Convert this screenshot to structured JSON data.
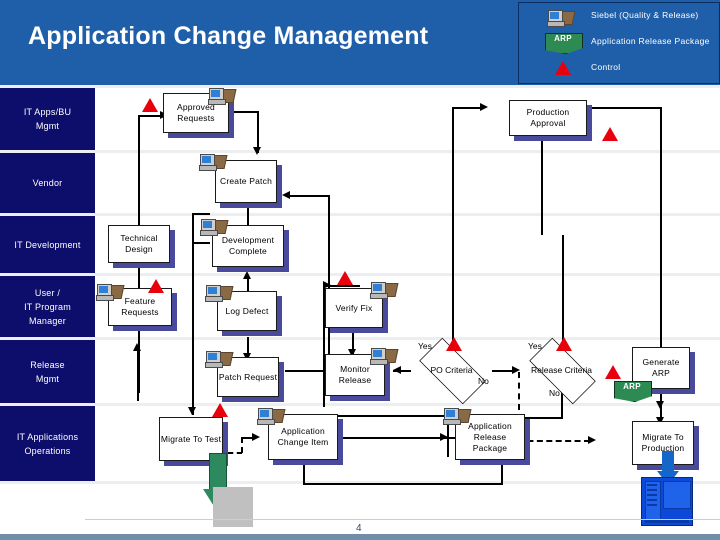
{
  "header": {
    "title": "Application Change Management",
    "banner_color": "#1f5fa9"
  },
  "legend": {
    "items": [
      {
        "icon": "computer-icon",
        "label": "Siebel (Quality & Release)"
      },
      {
        "icon": "arp-flag-icon",
        "label": "Application Release Package",
        "badge": "ARP"
      },
      {
        "icon": "control-triangle-icon",
        "label": "Control"
      }
    ]
  },
  "lanes": [
    {
      "label": "IT Apps/BU\nMgmt",
      "line1": "IT Apps/BU",
      "line2": "Mgmt"
    },
    {
      "label": "Vendor",
      "line1": "Vendor",
      "line2": ""
    },
    {
      "label": "IT Development",
      "line1": "IT Development",
      "line2": ""
    },
    {
      "label": "User / IT Program Manager",
      "line1": "User /",
      "line2": "IT Program",
      "line3": "Manager"
    },
    {
      "label": "Release Mgmt",
      "line1": "Release",
      "line2": "Mgmt"
    },
    {
      "label": "IT Applications Operations",
      "line1": "IT Applications",
      "line2": "Operations"
    }
  ],
  "nodes": {
    "approved_requests": "Approved Requests",
    "production_approval": "Production Approval",
    "create_patch": "Create Patch",
    "technical_design": "Technical Design",
    "development_complete": "Development Complete",
    "feature_requests": "Feature Requests",
    "log_defect": "Log Defect",
    "verify_fix": "Verify Fix",
    "patch_request": "Patch Request",
    "monitor_release": "Monitor Release",
    "generate_arp": "Generate ARP",
    "migrate_to_test": "Migrate To Test",
    "application_change_item": "Application Change Item",
    "application_release_package": "Application Release Package",
    "migrate_to_production": "Migrate To Production",
    "arp_artifact": "ARP"
  },
  "decisions": {
    "po_criteria": "PO Criteria",
    "release_criteria": "Release Criteria"
  },
  "edge_labels": {
    "po_yes": "Yes",
    "po_no": "No",
    "rel_yes": "Yes",
    "rel_no": "No"
  },
  "footer": {
    "page_number": "4"
  },
  "colors": {
    "banner": "#1f5fa9",
    "lane_header": "#0d0d6b",
    "box_shadow": "#4a4a9c",
    "control": "#e8000d",
    "arp_green": "#2d8a52",
    "server_blue": "#0d49d8"
  }
}
